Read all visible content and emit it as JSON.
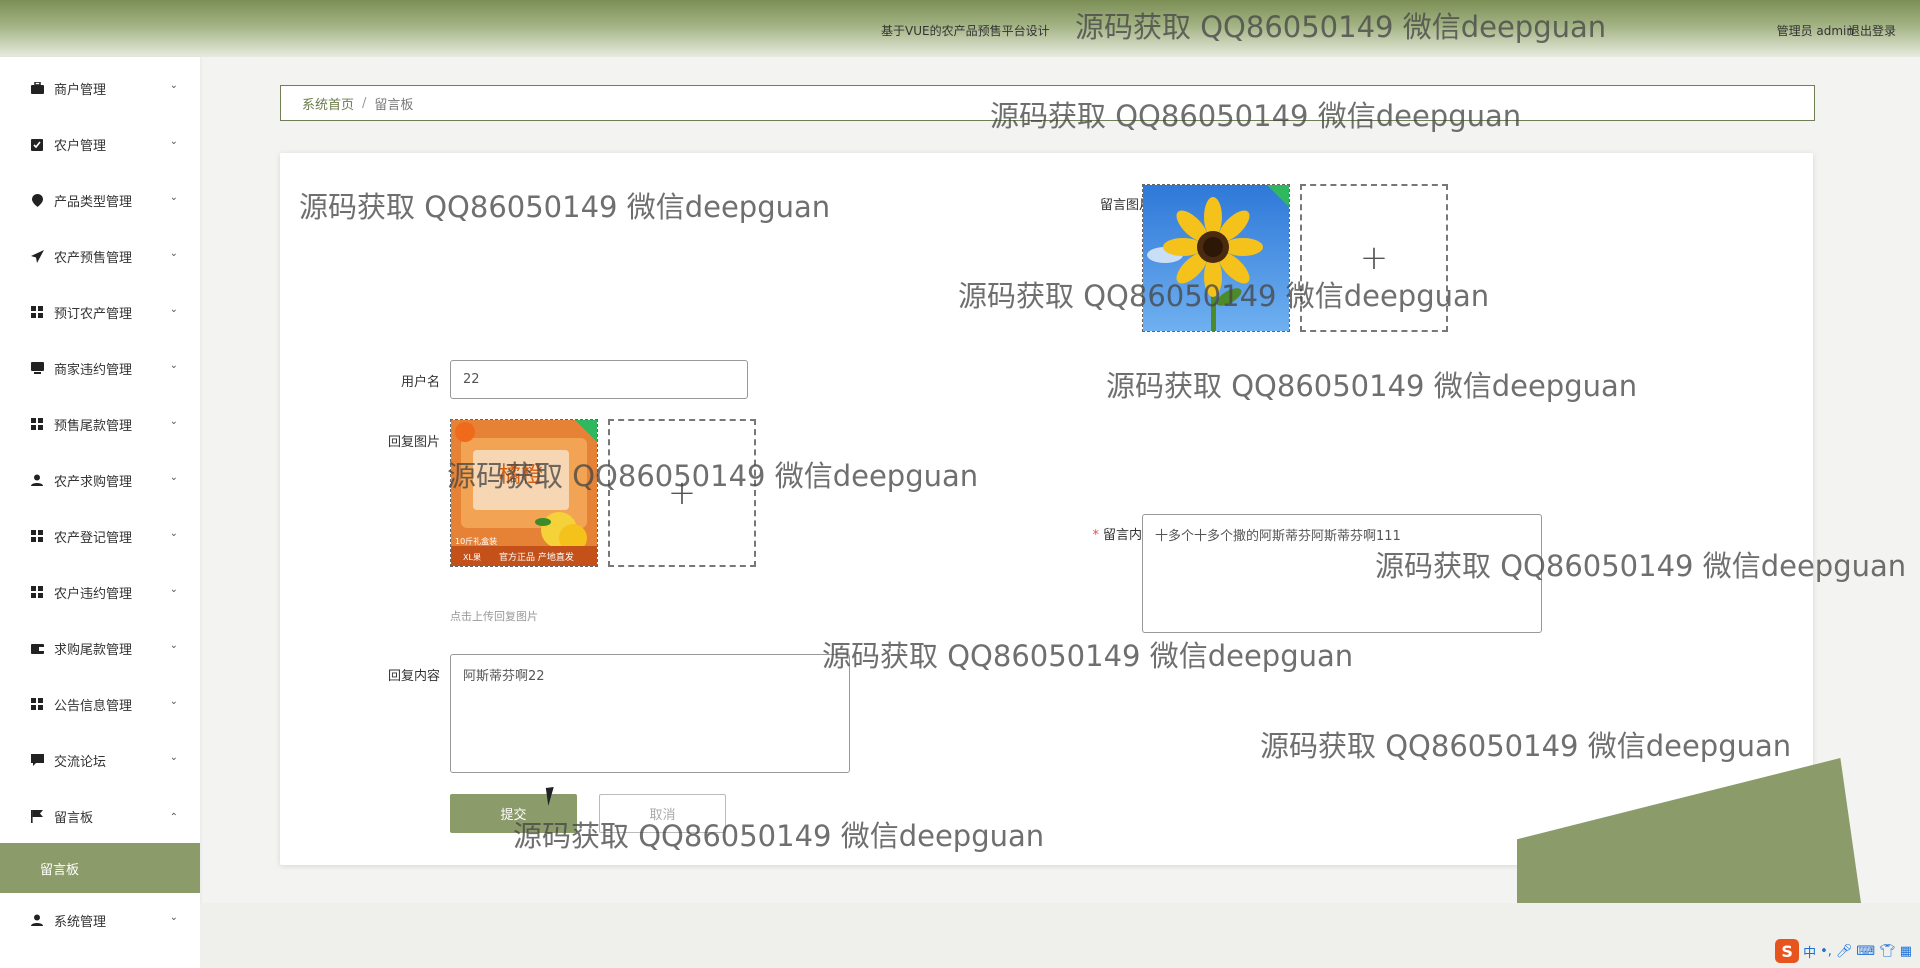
{
  "header": {
    "site_title": "基于VUE的农产品预售平台设计",
    "user": "管理员 admin",
    "logout": "退出登录"
  },
  "sidebar": {
    "items": [
      {
        "label": "商户管理",
        "icon": "briefcase-icon"
      },
      {
        "label": "农户管理",
        "icon": "clipboard-check-icon"
      },
      {
        "label": "产品类型管理",
        "icon": "map-pin-icon"
      },
      {
        "label": "农产预售管理",
        "icon": "paper-plane-icon"
      },
      {
        "label": "预订农产管理",
        "icon": "grid-icon"
      },
      {
        "label": "商家违约管理",
        "icon": "monitor-icon"
      },
      {
        "label": "预售尾款管理",
        "icon": "grid-icon"
      },
      {
        "label": "农产求购管理",
        "icon": "user-icon"
      },
      {
        "label": "农产登记管理",
        "icon": "grid-icon"
      },
      {
        "label": "农户违约管理",
        "icon": "grid-icon"
      },
      {
        "label": "求购尾款管理",
        "icon": "wallet-icon"
      },
      {
        "label": "公告信息管理",
        "icon": "grid-icon"
      },
      {
        "label": "交流论坛",
        "icon": "chat-icon"
      },
      {
        "label": "留言板",
        "icon": "flag-icon"
      }
    ],
    "active_subitem": "留言板",
    "last_item": {
      "label": "系统管理",
      "icon": "user-icon"
    }
  },
  "breadcrumb": {
    "home": "系统首页",
    "separator": "/",
    "current": "留言板"
  },
  "form": {
    "username_label": "用户名",
    "username_value": "22",
    "message_image_label": "留言图片",
    "reply_image_label": "回复图片",
    "reply_image_hint": "点击上传回复图片",
    "message_content_label": "留言内容",
    "message_content_value": "十多个十多个撒的阿斯蒂芬阿斯蒂芬啊111",
    "reply_content_label": "回复内容",
    "reply_content_value": "阿斯蒂芬啊22",
    "submit_label": "提交",
    "cancel_label": "取消"
  },
  "product_image": {
    "badge_top": "10斤礼盒装",
    "badge_size": "XL果",
    "text_main": "橘橙",
    "text_bottom": "官方正品 产地直发"
  },
  "watermark": "源码获取 QQ86050149 微信deepguan",
  "tray": {
    "ime": "S",
    "lang": "中"
  },
  "colors": {
    "accent": "#8c9b6a",
    "header_top": "#7b8f55",
    "required": "#e05050"
  }
}
